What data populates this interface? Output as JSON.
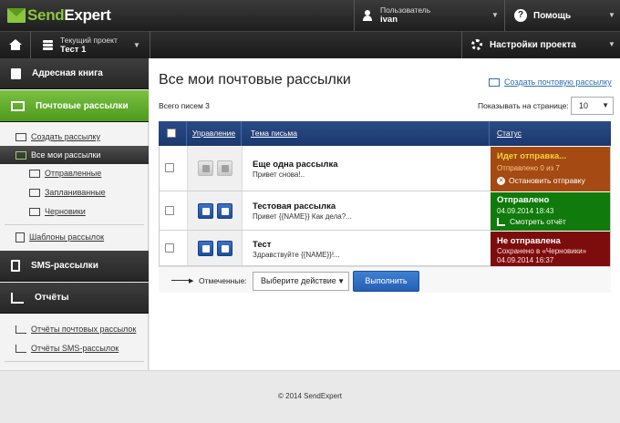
{
  "header": {
    "logo_part1": "Send",
    "logo_part2": "Expert",
    "user_label": "Пользователь",
    "user_name": "ivan",
    "help_label": "Помощь"
  },
  "projectbar": {
    "project_label": "Текущий проект",
    "project_name": "Тест 1",
    "settings_label": "Настройки проекта"
  },
  "sidebar": {
    "address_book": "Адресная книга",
    "mailings": "Почтовые рассылки",
    "create_mailing": "Создать рассылку",
    "all_mailings": "Все мои рассылки",
    "sent": "Отправленные",
    "scheduled": "Запланиванные",
    "drafts": "Черновики",
    "templates": "Шаблоны рассылок",
    "sms": "SMS-рассылки",
    "reports": "Отчёты",
    "mail_reports": "Отчёты почтовых рассылок",
    "sms_reports": "Отчёты SMS-рассылок"
  },
  "main": {
    "title": "Все мои почтовые рассылки",
    "create_link": "Создать почтовую рассылку",
    "count": "Всего писем 3",
    "per_page_label": "Показывать на странице:",
    "per_page_value": "10"
  },
  "table": {
    "col_control": "Управление",
    "col_subject": "Тема письма",
    "col_status": "Статус",
    "rows": [
      {
        "title": "Еще одна рассылка",
        "preview": "Привет снова!..",
        "status": "Идет отправка...",
        "status_detail": "Отправлено 0 из 7",
        "status_action": "Остановить отправку",
        "status_color": "#a44a12"
      },
      {
        "title": "Тестовая рассылка",
        "preview": "Привет {{NAME}} Как дела?...",
        "status": "Отправлено",
        "status_detail": "04.09.2014 18:43",
        "status_action": "Смотреть отчёт",
        "status_color": "#117a0c"
      },
      {
        "title": "Тест",
        "preview": "Здравствуйте {{NAME}}!...",
        "status": "Не отправлена",
        "status_detail": "Сохранено в «Черновики»",
        "status_detail2": "04.09.2014 16:37",
        "status_color": "#7d0d0d"
      }
    ],
    "marked_label": "Отмеченные:",
    "action_select": "Выберите действие",
    "run_button": "Выполнить"
  },
  "footer": {
    "copyright": "© 2014 SendExpert"
  },
  "colors": {
    "accent_green": "#7ac142",
    "header_blue": "#1f3f7a",
    "button_blue": "#2f6fc4"
  }
}
